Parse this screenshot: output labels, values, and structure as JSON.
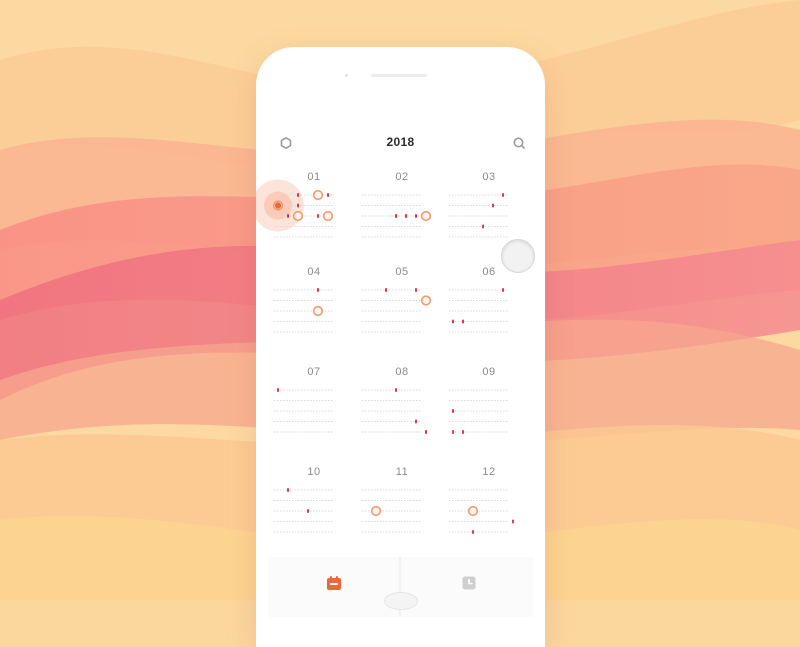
{
  "header": {
    "year": "2018",
    "left_icon": "settings-icon",
    "right_icon": "search-icon"
  },
  "months": [
    {
      "label": "01",
      "rings": [
        [
          1,
          0
        ],
        [
          0,
          4
        ],
        [
          2,
          2
        ],
        [
          2,
          5
        ]
      ],
      "dots": [
        [
          0,
          2
        ],
        [
          0,
          5
        ],
        [
          1,
          2
        ],
        [
          2,
          1
        ],
        [
          2,
          4
        ]
      ],
      "highlight": [
        1,
        0
      ]
    },
    {
      "label": "02",
      "rings": [
        [
          2,
          6
        ]
      ],
      "dots": [
        [
          2,
          3
        ],
        [
          2,
          4
        ],
        [
          2,
          5
        ]
      ]
    },
    {
      "label": "03",
      "rings": [],
      "dots": [
        [
          0,
          5
        ],
        [
          1,
          4
        ],
        [
          3,
          3
        ]
      ]
    },
    {
      "label": "04",
      "rings": [
        [
          2,
          4
        ]
      ],
      "dots": [
        [
          0,
          4
        ]
      ]
    },
    {
      "label": "05",
      "rings": [
        [
          1,
          6
        ]
      ],
      "dots": [
        [
          0,
          2
        ],
        [
          0,
          5
        ]
      ]
    },
    {
      "label": "06",
      "rings": [],
      "dots": [
        [
          0,
          5
        ],
        [
          3,
          0
        ],
        [
          3,
          1
        ]
      ]
    },
    {
      "label": "07",
      "rings": [],
      "dots": [
        [
          0,
          0
        ]
      ]
    },
    {
      "label": "08",
      "rings": [],
      "dots": [
        [
          0,
          3
        ],
        [
          3,
          5
        ],
        [
          4,
          6
        ]
      ]
    },
    {
      "label": "09",
      "rings": [],
      "dots": [
        [
          2,
          0
        ],
        [
          4,
          0
        ],
        [
          4,
          1
        ]
      ]
    },
    {
      "label": "10",
      "rings": [],
      "dots": [
        [
          0,
          1
        ],
        [
          2,
          3
        ]
      ]
    },
    {
      "label": "11",
      "rings": [
        [
          2,
          1
        ]
      ],
      "dots": []
    },
    {
      "label": "12",
      "rings": [
        [
          2,
          2
        ]
      ],
      "dots": [
        [
          3,
          6
        ],
        [
          4,
          2
        ]
      ]
    }
  ],
  "tabs": [
    {
      "name": "calendar",
      "icon": "calendar-icon",
      "active": true
    },
    {
      "name": "clock",
      "icon": "clock-icon",
      "active": false
    }
  ],
  "colors": {
    "accent": "#f0653a",
    "dot": "#e0364e",
    "ring": "#f39a6d",
    "line": "#d9d9d9",
    "inactive_icon": "#c8c8c8",
    "text_dark": "#2b2b2b",
    "text_muted": "#8a8a8a"
  }
}
